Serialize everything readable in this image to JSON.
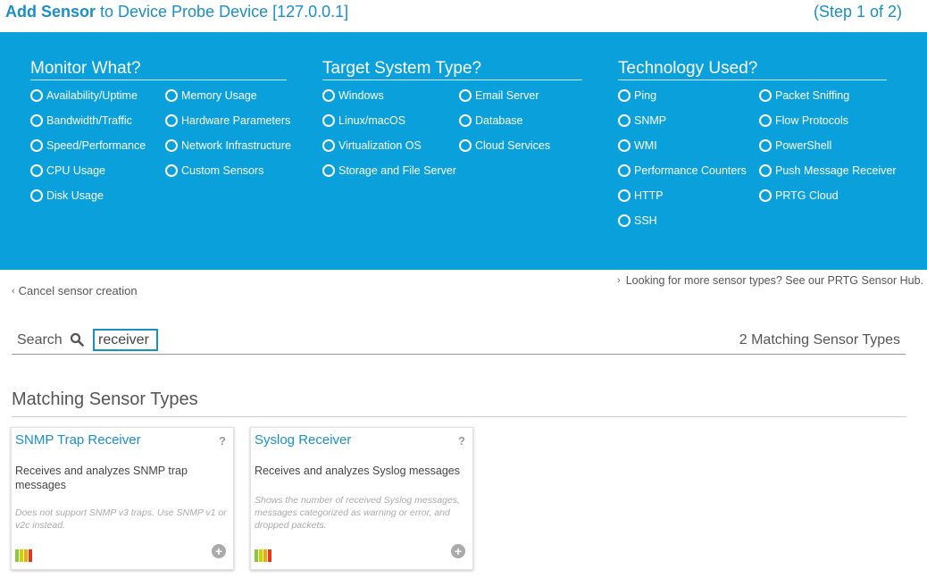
{
  "header": {
    "title_bold": "Add Sensor",
    "title_rest": " to Device Probe Device [127.0.0.1]",
    "step": "(Step 1 of 2)"
  },
  "filters": {
    "monitor": {
      "title": "Monitor What?",
      "options": [
        "Availability/Uptime",
        "Bandwidth/Traffic",
        "Speed/Performance",
        "CPU Usage",
        "Disk Usage",
        "Memory Usage",
        "Hardware Parameters",
        "Network Infrastructure",
        "Custom Sensors"
      ]
    },
    "target": {
      "title": "Target System Type?",
      "options": [
        "Windows",
        "Linux/macOS",
        "Virtualization OS",
        "Storage and File Server",
        "Email Server",
        "Database",
        "Cloud Services"
      ]
    },
    "technology": {
      "title": "Technology Used?",
      "options": [
        "Ping",
        "SNMP",
        "WMI",
        "Performance Counters",
        "HTTP",
        "SSH",
        "Packet Sniffing",
        "Flow Protocols",
        "PowerShell",
        "Push Message Receiver",
        "PRTG Cloud"
      ]
    }
  },
  "links": {
    "cancel": "Cancel sensor creation",
    "hub": "Looking for more sensor types? See our PRTG Sensor Hub."
  },
  "search": {
    "label": "Search",
    "value": "receiver",
    "match_count": "2 Matching Sensor Types"
  },
  "section_title": "Matching Sensor Types",
  "cards": [
    {
      "title": "SNMP Trap Receiver",
      "description": "Receives and analyzes SNMP trap messages",
      "note": "Does not support SNMP v3 traps. Use SNMP v1 or v2c instead."
    },
    {
      "title": "Syslog Receiver",
      "description": "Receives and analyzes Syslog messages",
      "note": "Shows the number of received Syslog messages, messages categorized as warning or error, and dropped packets."
    }
  ],
  "colors": {
    "accent": "#1a8fc4",
    "panel": "#0aa0dc",
    "impact_bars": [
      "#8dc63f",
      "#c8d400",
      "#f7a800",
      "#e03a1e"
    ]
  }
}
